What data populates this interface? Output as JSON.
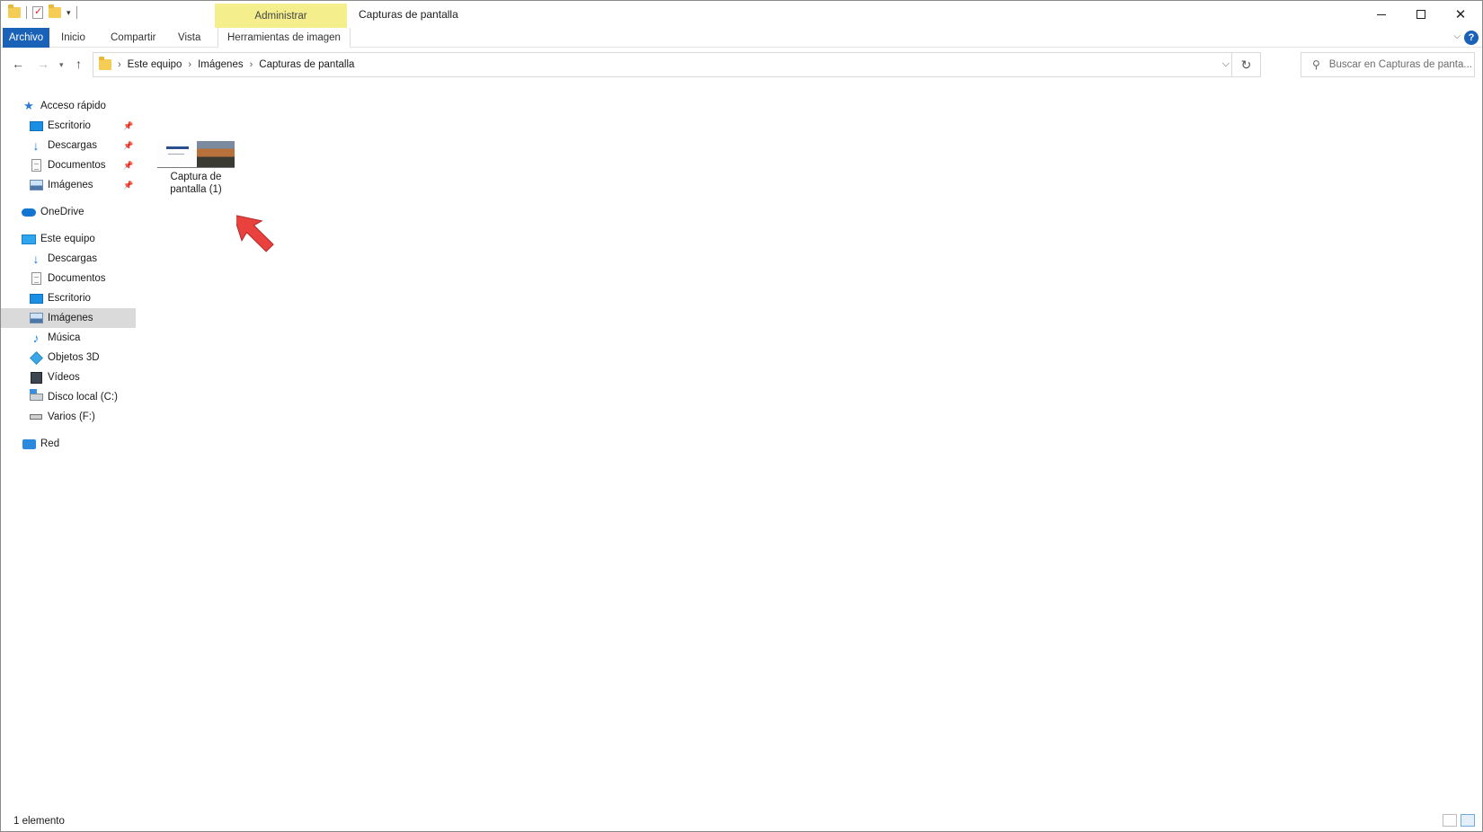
{
  "window": {
    "title": "Capturas de pantalla",
    "context_tab_group": "Administrar"
  },
  "ribbon": {
    "tabs": [
      "Archivo",
      "Inicio",
      "Compartir",
      "Vista",
      "Herramientas de imagen"
    ]
  },
  "address": {
    "crumbs": [
      "Este equipo",
      "Imágenes",
      "Capturas de pantalla"
    ],
    "search_placeholder": "Buscar en Capturas de panta..."
  },
  "navpane": {
    "quick_access": {
      "label": "Acceso rápido",
      "items": [
        "Escritorio",
        "Descargas",
        "Documentos",
        "Imágenes"
      ]
    },
    "onedrive": "OneDrive",
    "this_pc": {
      "label": "Este equipo",
      "items": [
        "Descargas",
        "Documentos",
        "Escritorio",
        "Imágenes",
        "Música",
        "Objetos 3D",
        "Vídeos",
        "Disco local (C:)",
        "Varios (F:)"
      ]
    },
    "network": "Red",
    "selected": "Imágenes"
  },
  "content": {
    "files": [
      {
        "name_line1": "Captura de",
        "name_line2": "pantalla (1)"
      }
    ]
  },
  "status": {
    "count": "1 elemento"
  },
  "colors": {
    "archivo_tab": "#1a62b8",
    "context_tab": "#f4ef8c",
    "selection": "#dadada",
    "annotation_arrow": "#e8413e"
  }
}
